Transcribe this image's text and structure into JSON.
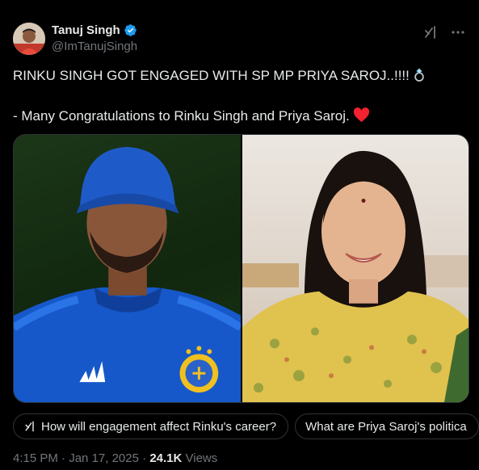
{
  "author": {
    "display_name": "Tanuj Singh",
    "handle": "@ImTanujSingh",
    "verified": true,
    "avatar": "profile-photo"
  },
  "header_actions": [
    {
      "icon": "grok-icon"
    },
    {
      "icon": "more-icon"
    }
  ],
  "tweet": {
    "line1": "RINKU SINGH GOT ENGAGED WITH SP MP PRIYA SAROJ..!!!!",
    "line1_emoji": "ring-icon",
    "line2": "- Many Congratulations to Rinku Singh and Priya Saroj.",
    "line2_emoji": "heart-icon"
  },
  "media": {
    "left_photo": "man-in-blue-cricket-jersey",
    "right_photo": "woman-in-yellow-dupatta"
  },
  "grok_suggestions": [
    {
      "label": "How will engagement affect Rinku's career?",
      "icon": "grok-icon"
    },
    {
      "label": "What are Priya Saroj's politica"
    }
  ],
  "meta": {
    "time": "4:15 PM",
    "separator": "·",
    "date": "Jan 17, 2025",
    "views_count": "24.1K",
    "views_label": "Views"
  },
  "colors": {
    "background": "#000000",
    "text": "#e7e9ea",
    "muted": "#71767b",
    "border": "#2f3336",
    "verified": "#1d9bf0",
    "heart": "#f4212e"
  }
}
